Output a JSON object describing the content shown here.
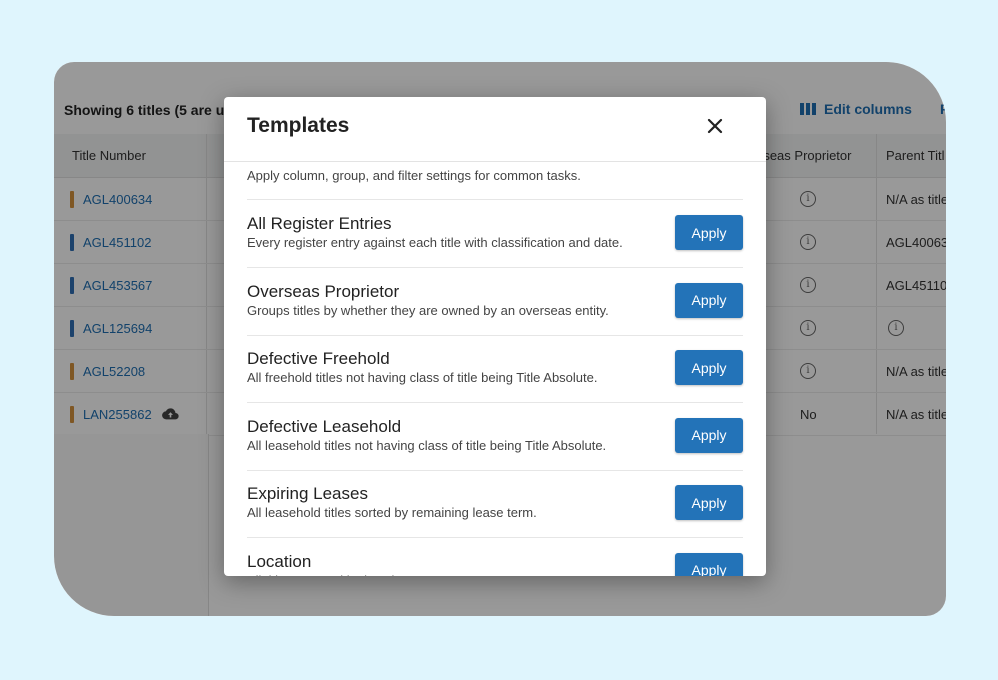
{
  "background_table": {
    "showing_text": "Showing 6 titles (5 are u",
    "edit_columns_label": "Edit columns",
    "overflow_header_fragment": "F",
    "columns": {
      "title_number": "Title Number",
      "overseas_proprietor": "rseas Proprietor",
      "parent_title": "Parent Titl"
    },
    "rows": [
      {
        "title_number": "AGL400634",
        "marker_color": "#d4913d",
        "overseas": "info",
        "parent": "N/A as title"
      },
      {
        "title_number": "AGL451102",
        "marker_color": "#2f6fb5",
        "overseas": "info",
        "parent": "AGL400634"
      },
      {
        "title_number": "AGL453567",
        "marker_color": "#2f6fb5",
        "overseas": "info",
        "parent": "AGL451102"
      },
      {
        "title_number": "AGL125694",
        "marker_color": "#2f6fb5",
        "overseas": "info",
        "parent": "info"
      },
      {
        "title_number": "AGL52208",
        "marker_color": "#d4913d",
        "overseas": "info",
        "parent": "N/A as title"
      },
      {
        "title_number": "LAN255862",
        "marker_color": "#d4913d",
        "overseas": "No",
        "parent": "N/A as title",
        "cloud_icon": true
      }
    ]
  },
  "modal": {
    "title": "Templates",
    "close_icon": "close-icon",
    "intro": "Apply column, group, and filter settings for common tasks.",
    "templates": [
      {
        "name": "All Register Entries",
        "description": "Every register entry against each title with classification and date.",
        "button": "Apply"
      },
      {
        "name": "Overseas Proprietor",
        "description": "Groups titles by whether they are owned by an overseas entity.",
        "button": "Apply"
      },
      {
        "name": "Defective Freehold",
        "description": "All freehold titles not having class of title being Title Absolute.",
        "button": "Apply"
      },
      {
        "name": "Defective Leasehold",
        "description": "All leasehold titles not having class of title being Title Absolute.",
        "button": "Apply"
      },
      {
        "name": "Expiring Leases",
        "description": "All leasehold titles sorted by remaining lease term.",
        "button": "Apply"
      },
      {
        "name": "Location",
        "description": "All titles grouped by location",
        "button": "Apply"
      }
    ]
  },
  "colors": {
    "page_bg": "#dff5fd",
    "accent": "#2373b8",
    "link": "#1f6fb2"
  }
}
